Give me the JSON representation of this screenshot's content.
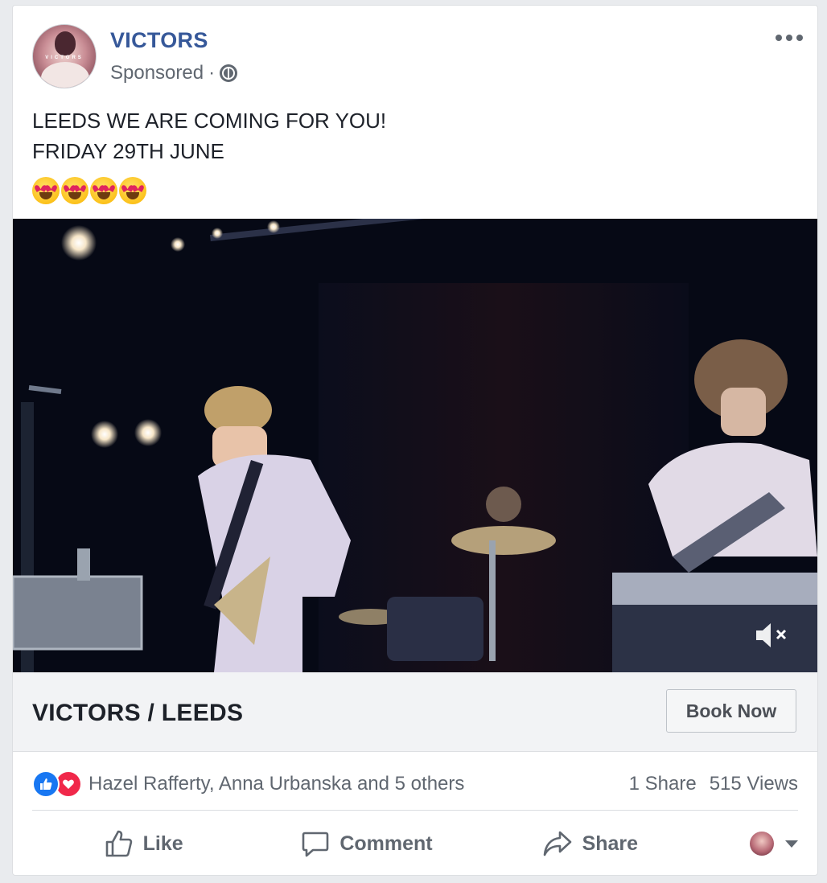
{
  "post": {
    "page_name": "VICTORS",
    "avatar_text": "VICTORS",
    "sponsored_label": "Sponsored",
    "separator": "·",
    "audience_icon": "globe-icon",
    "menu_icon": "more-options-icon",
    "text_lines": [
      "LEEDS WE ARE COMING FOR YOU!",
      "FRIDAY 29TH JUNE"
    ],
    "emoji_name": "smiling-face-with-heart-eyes",
    "emoji_count": 4
  },
  "video": {
    "description_icon": "band-on-stage-video",
    "mute_icon": "muted-speaker-icon",
    "muted": true
  },
  "link": {
    "title": "VICTORS / LEEDS",
    "cta_label": "Book Now"
  },
  "engagement": {
    "reaction_icons": [
      "like-reaction-icon",
      "love-reaction-icon"
    ],
    "reactors_text": "Hazel Rafferty, Anna Urbanska and 5 others",
    "shares_text": "1 Share",
    "views_text": "515 Views"
  },
  "actions": {
    "like_label": "Like",
    "comment_label": "Comment",
    "share_label": "Share"
  },
  "colors": {
    "page_name": "#365899",
    "like_blue": "#1877f2",
    "love_red": "#f0284a",
    "secondary_text": "#606770"
  }
}
